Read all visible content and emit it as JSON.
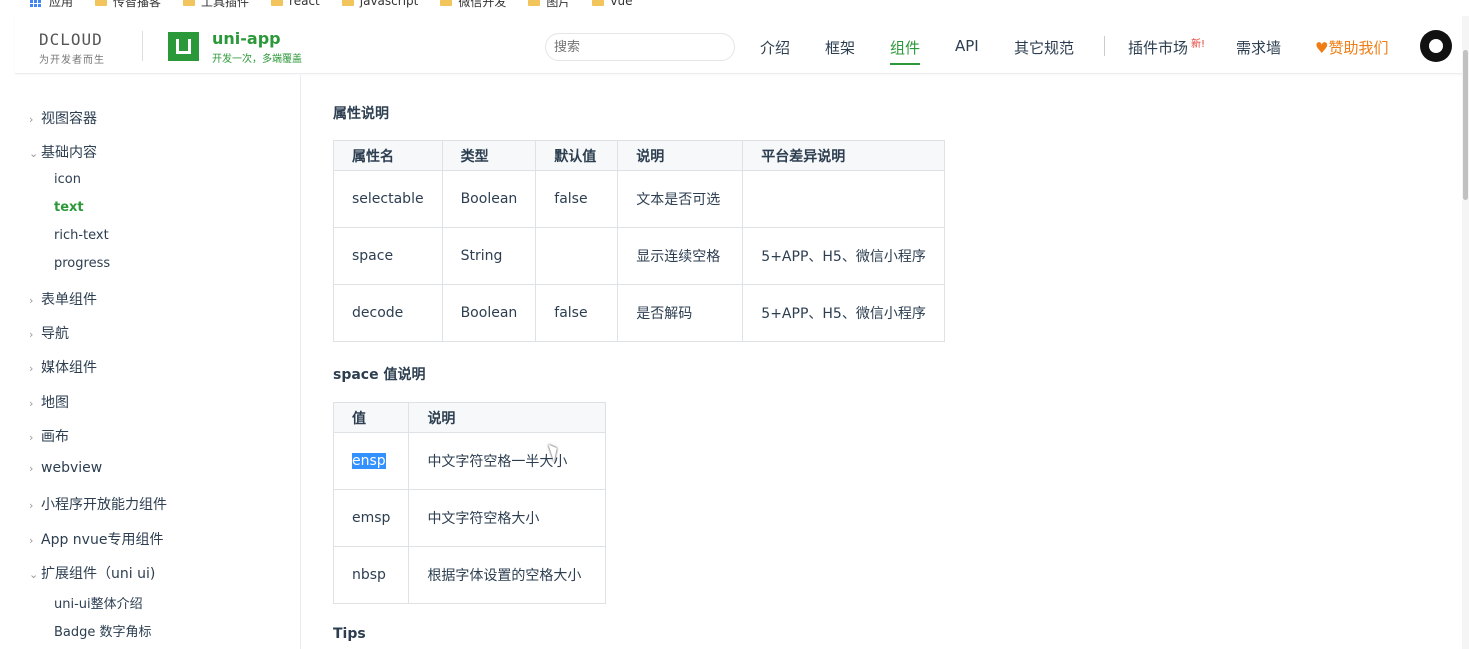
{
  "bookmarks": [
    "应用",
    "传智播客",
    "工具插件",
    "react",
    "javascript",
    "微信开发",
    "图片",
    "vue"
  ],
  "header": {
    "brand": "DCLOUD",
    "brand_sub": "为开发者而生",
    "product": "uni-app",
    "product_sub": "开发一次，多端覆盖",
    "search_placeholder": "搜索",
    "nav": [
      "介绍",
      "框架",
      "组件",
      "API",
      "其它规范"
    ],
    "nav_active": "组件",
    "plugin_market": "插件市场",
    "new_badge": "新!",
    "demand_wall": "需求墙",
    "sponsor": "♥赞助我们",
    "accent_color": "#2b9939"
  },
  "sidebar": {
    "items": [
      "视图容器",
      "基础内容",
      "表单组件",
      "导航",
      "媒体组件",
      "地图",
      "画布",
      "webview",
      "小程序开放能力组件",
      "App nvue专用组件",
      "扩展组件（uni ui)"
    ],
    "basic_children": [
      "icon",
      "text",
      "rich-text",
      "progress"
    ],
    "ext_children": [
      "uni-ui整体介绍",
      "Badge 数字角标"
    ],
    "active": "text"
  },
  "content": {
    "attr_title": "属性说明",
    "attr_headers": [
      "属性名",
      "类型",
      "默认值",
      "说明",
      "平台差异说明"
    ],
    "attr_rows": [
      [
        "selectable",
        "Boolean",
        "false",
        "文本是否可选",
        ""
      ],
      [
        "space",
        "String",
        "",
        "显示连续空格",
        "5+APP、H5、微信小程序"
      ],
      [
        "decode",
        "Boolean",
        "false",
        "是否解码",
        "5+APP、H5、微信小程序"
      ]
    ],
    "space_title": "space 值说明",
    "space_headers": [
      "值",
      "说明"
    ],
    "space_rows": [
      [
        "ensp",
        "中文字符空格一半大小"
      ],
      [
        "emsp",
        "中文字符空格大小"
      ],
      [
        "nbsp",
        "根据字体设置的空格大小"
      ]
    ],
    "tips_title": "Tips"
  }
}
